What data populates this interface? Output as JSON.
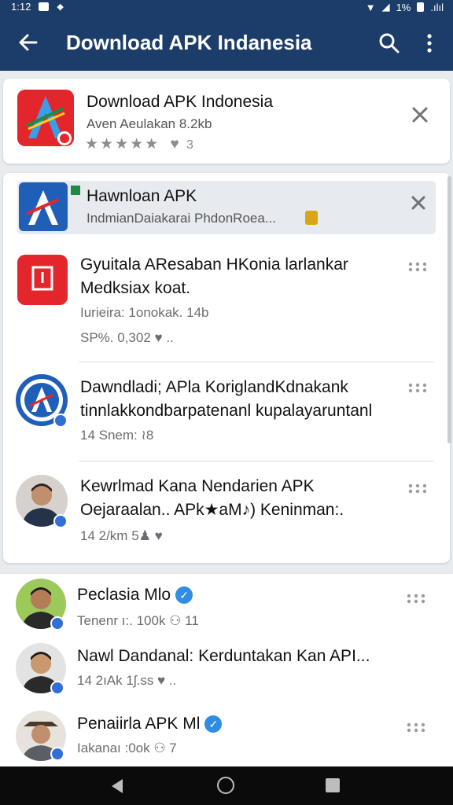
{
  "status_bar": {
    "time": "1:12",
    "battery": "1%",
    "signal": ".ılıl"
  },
  "app_bar": {
    "title": "Download APK Indanesia"
  },
  "top_card": {
    "name": "Download APK Indonesia",
    "sub": "Aven Aeulakan 8.2kb",
    "stars": "★★★★★",
    "count": "3"
  },
  "banner": {
    "title": "Hawnloan APK",
    "sub": "IndmianDaiakarai PhdonRoea..."
  },
  "feed": [
    {
      "title_line1": "Gyuitala AResaban HKonia larlankar",
      "title_line2": "Medksiax koat.",
      "meta_line1": "Iurieira: 1onokak. 14b",
      "meta_line2": "SP%. 0,302 ♥ .."
    },
    {
      "title_line1": "Dawndladi; APla KoriglandKdnakank",
      "title_line2": "tinnlakkondbarpatenanl kupalayaruntanl",
      "meta_line1": "14 Snem: ≀8"
    },
    {
      "title_line1": "Kewrlmad Kana Nendarien APK",
      "title_line2": "Oejaraalan.. APk★aM♪) Keninman:.",
      "meta_line1": "14 2/km 5♟ ♥"
    }
  ],
  "people": [
    {
      "name": "Peclasia Mlo",
      "meta": "Tenenr ı:. 100k ⚇ 11"
    },
    {
      "name": "Nawl Dandanal: Kerduntakan Kan API...",
      "meta": "14 2ıAk 1ʃ.ss ♥ .."
    },
    {
      "name": "Penaiirla APK Ml",
      "meta": "Iakanaı :0ok ⚇ 7"
    }
  ],
  "colors": {
    "app_bar": "#1c3c69",
    "accent": "#2f6fd6",
    "icon_red": "#e3262b",
    "icon_blue": "#1f5fb8"
  },
  "icons": [
    "back-arrow-icon",
    "search-icon",
    "more-vert-icon",
    "close-icon",
    "star-icon",
    "heart-icon"
  ]
}
